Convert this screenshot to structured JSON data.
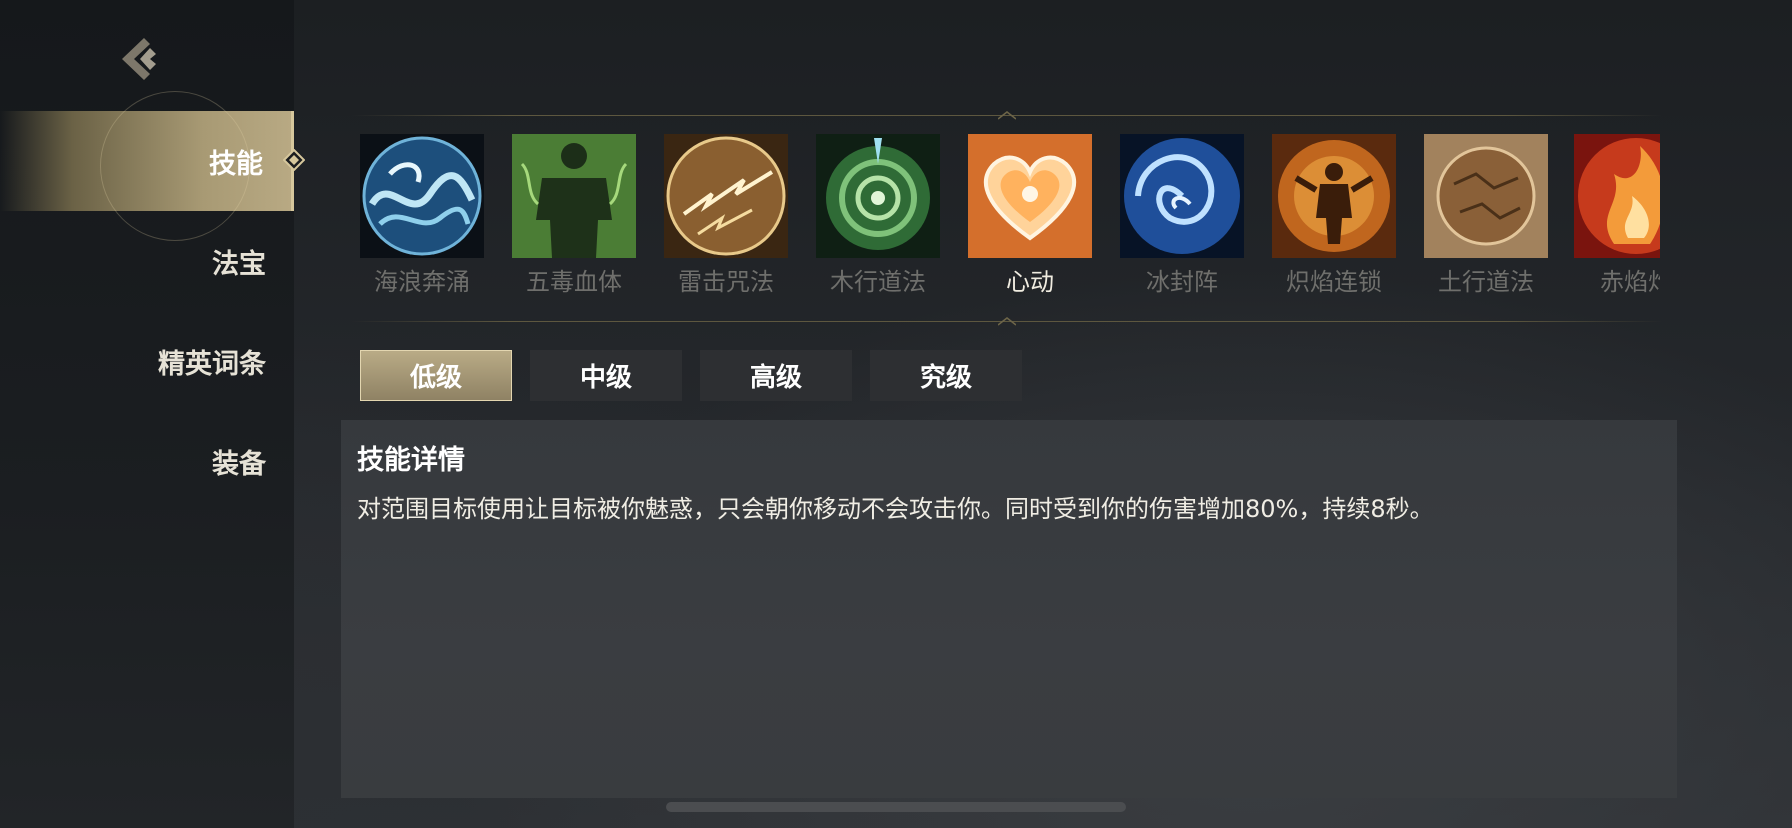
{
  "sidebar": {
    "items": [
      {
        "label": "技能"
      },
      {
        "label": "法宝"
      },
      {
        "label": "精英词条"
      },
      {
        "label": "装备"
      }
    ]
  },
  "skills": [
    {
      "name": "海浪奔涌",
      "icon": "ocean-wave-icon"
    },
    {
      "name": "五毒血体",
      "icon": "poison-body-icon"
    },
    {
      "name": "雷击咒法",
      "icon": "lightning-icon"
    },
    {
      "name": "木行道法",
      "icon": "wood-vortex-icon"
    },
    {
      "name": "心动",
      "icon": "heart-fire-icon"
    },
    {
      "name": "冰封阵",
      "icon": "ice-swirl-icon"
    },
    {
      "name": "炽焰连锁",
      "icon": "flame-chain-icon"
    },
    {
      "name": "土行道法",
      "icon": "earth-orb-icon"
    },
    {
      "name": "赤焰灼",
      "icon": "red-flame-icon"
    }
  ],
  "tiers": [
    {
      "label": "低级"
    },
    {
      "label": "中级"
    },
    {
      "label": "高级"
    },
    {
      "label": "究级"
    }
  ],
  "detail": {
    "title": "技能详情",
    "description": "对范围目标使用让目标被你魅惑，只会朝你移动不会攻击你。同时受到你的伤害增加80%，持续8秒。"
  },
  "colors": {
    "accent_gold": "#b8a983",
    "panel_bg": "#36393d",
    "selected_text": "#f0ece0",
    "inactive_text": "#6f6f6c"
  }
}
